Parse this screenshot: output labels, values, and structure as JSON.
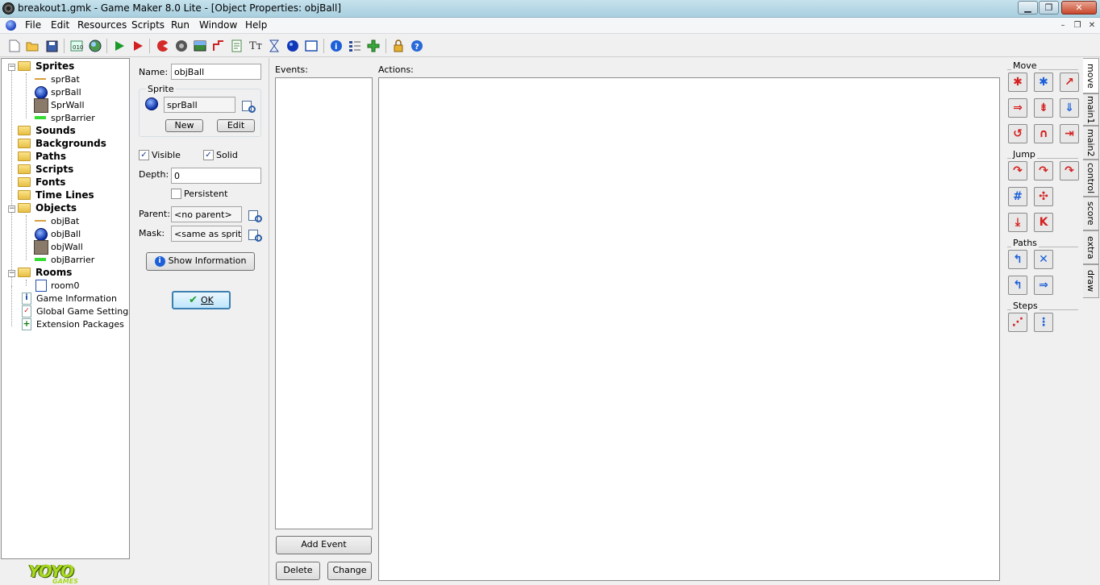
{
  "window": {
    "title": "breakout1.gmk - Game Maker 8.0 Lite - [Object Properties: objBall]",
    "min": "▁",
    "max": "❐",
    "close": "✕"
  },
  "menu": [
    "File",
    "Edit",
    "Resources",
    "Scripts",
    "Run",
    "Window",
    "Help"
  ],
  "mdi": {
    "min": "–",
    "restore": "❐",
    "close": "✕"
  },
  "tree": {
    "sprites": "Sprites",
    "spr_items": [
      "sprBat",
      "sprBall",
      "SprWall",
      "sprBarrier"
    ],
    "sounds": "Sounds",
    "backgrounds": "Backgrounds",
    "paths": "Paths",
    "scripts": "Scripts",
    "fonts": "Fonts",
    "timelines": "Time Lines",
    "objects": "Objects",
    "obj_items": [
      "objBat",
      "objBall",
      "objWall",
      "objBarrier"
    ],
    "rooms": "Rooms",
    "room_items": [
      "room0"
    ],
    "game_info": "Game Information",
    "global_settings": "Global Game Settings",
    "extensions": "Extension Packages"
  },
  "brand": {
    "logo": "YOYO",
    "sub": "GAMES"
  },
  "props": {
    "name_label": "Name:",
    "name_value": "objBall",
    "sprite_group": "Sprite",
    "sprite_value": "sprBall",
    "new_label": "New",
    "edit_label": "Edit",
    "visible_label": "Visible",
    "visible_checked": true,
    "solid_label": "Solid",
    "solid_checked": true,
    "depth_label": "Depth:",
    "depth_value": "0",
    "persistent_label": "Persistent",
    "persistent_checked": false,
    "parent_label": "Parent:",
    "parent_value": "<no parent>",
    "mask_label": "Mask:",
    "mask_value": "<same as sprite>",
    "show_info_label": "Show Information",
    "ok_label": "OK"
  },
  "events": {
    "label": "Events:",
    "add_label": "Add Event",
    "delete_label": "Delete",
    "change_label": "Change"
  },
  "actions": {
    "label": "Actions:"
  },
  "palette": {
    "move_label": "Move",
    "jump_label": "Jump",
    "paths_label": "Paths",
    "steps_label": "Steps",
    "tabs": [
      "move",
      "main1",
      "main2",
      "control",
      "score",
      "extra",
      "draw"
    ],
    "active_tab": "move"
  }
}
